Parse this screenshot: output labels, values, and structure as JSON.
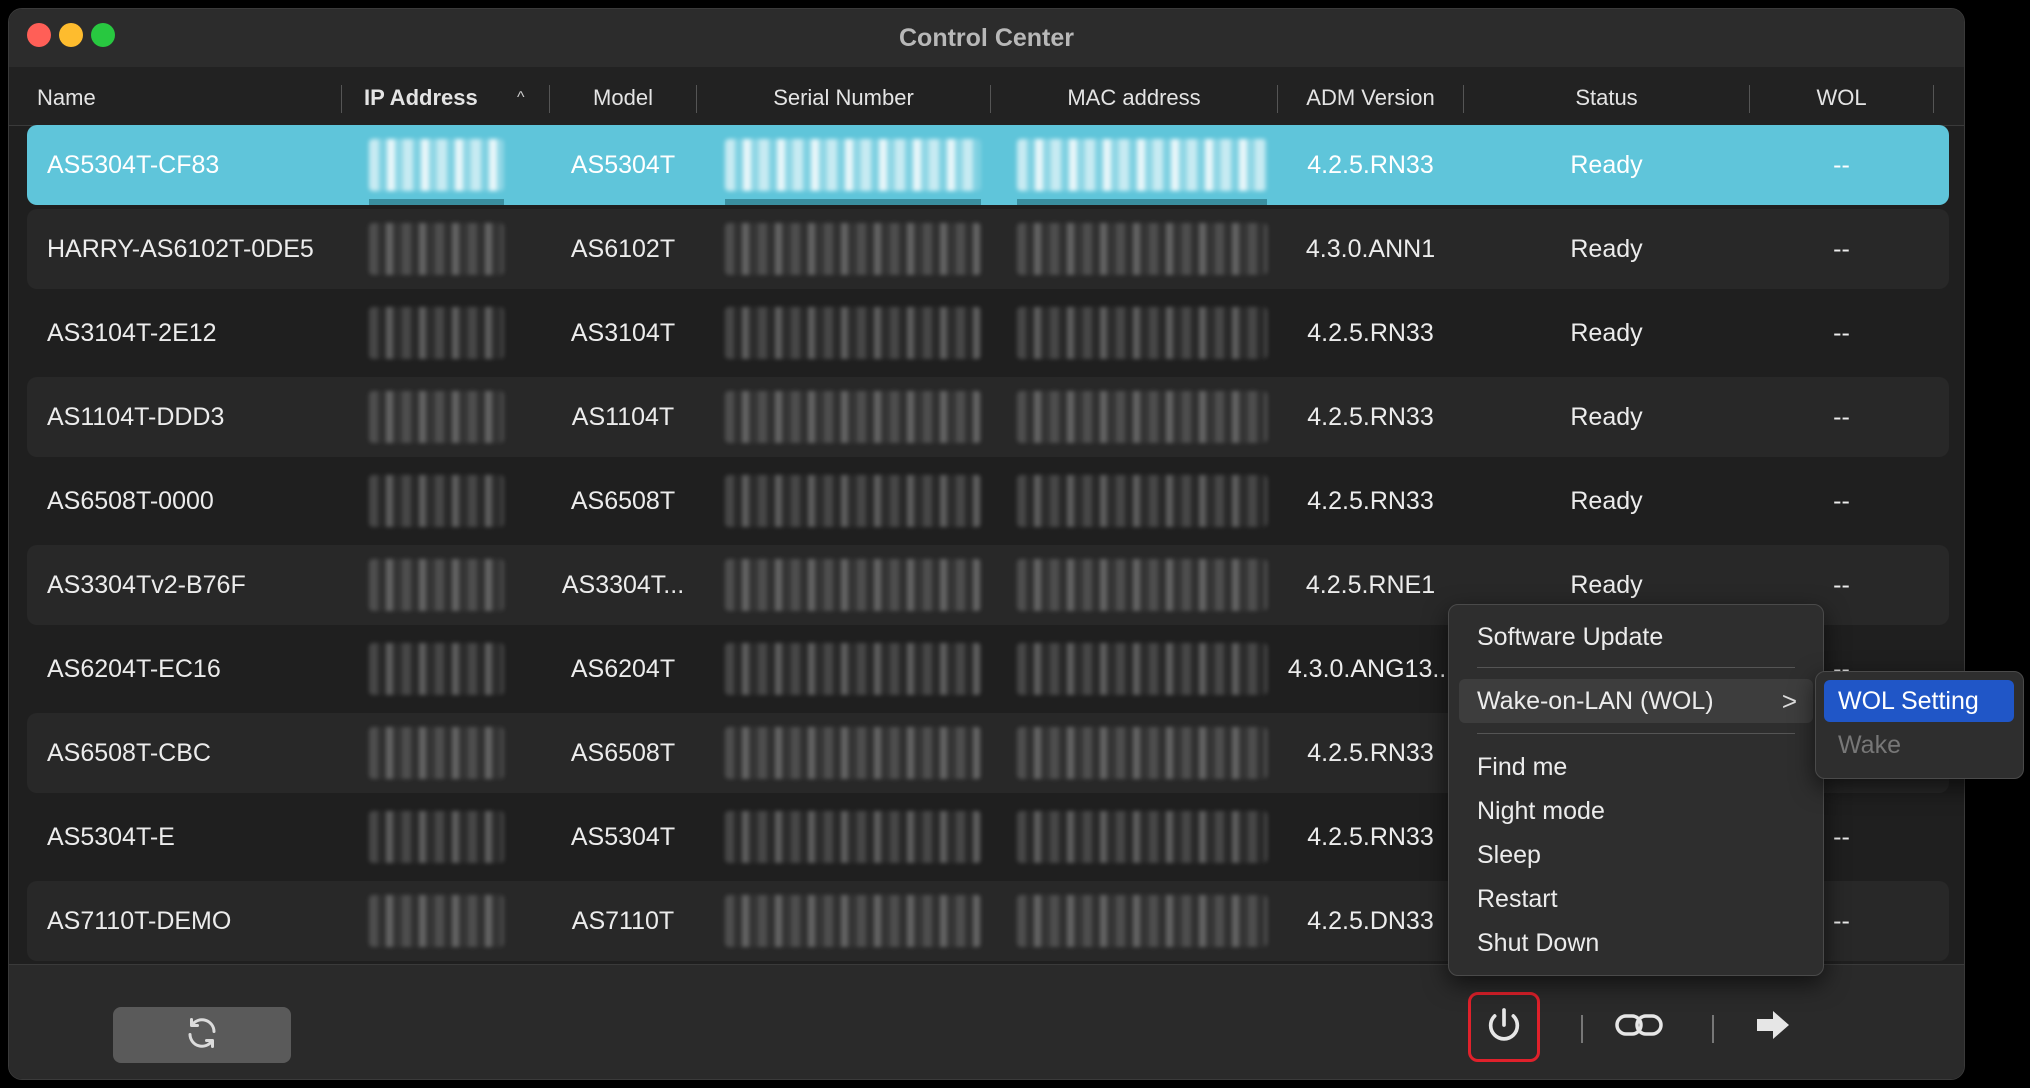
{
  "window": {
    "title": "Control Center"
  },
  "columns": [
    {
      "key": "name",
      "label": "Name"
    },
    {
      "key": "ip",
      "label": "IP Address",
      "sorted": true,
      "sort_indicator": "^"
    },
    {
      "key": "model",
      "label": "Model"
    },
    {
      "key": "serial",
      "label": "Serial Number"
    },
    {
      "key": "mac",
      "label": "MAC address"
    },
    {
      "key": "adm",
      "label": "ADM Version"
    },
    {
      "key": "status",
      "label": "Status"
    },
    {
      "key": "wol",
      "label": "WOL"
    }
  ],
  "rows": [
    {
      "name": "AS5304T-CF83",
      "model": "AS5304T",
      "adm": "4.2.5.RN33",
      "status": "Ready",
      "wol": "--",
      "selected": true
    },
    {
      "name": "HARRY-AS6102T-0DE5",
      "model": "AS6102T",
      "adm": "4.3.0.ANN1",
      "status": "Ready",
      "wol": "--"
    },
    {
      "name": "AS3104T-2E12",
      "model": "AS3104T",
      "adm": "4.2.5.RN33",
      "status": "Ready",
      "wol": "--"
    },
    {
      "name": "AS1104T-DDD3",
      "model": "AS1104T",
      "adm": "4.2.5.RN33",
      "status": "Ready",
      "wol": "--"
    },
    {
      "name": "AS6508T-0000",
      "model": "AS6508T",
      "adm": "4.2.5.RN33",
      "status": "Ready",
      "wol": "--"
    },
    {
      "name": "AS3304Tv2-B76F",
      "model": "AS3304T...",
      "adm": "4.2.5.RNE1",
      "status": "Ready",
      "wol": "--"
    },
    {
      "name": "AS6204T-EC16",
      "model": "AS6204T",
      "adm": "4.3.0.ANG13...",
      "status": "",
      "wol": "--"
    },
    {
      "name": "AS6508T-CBC",
      "model": "AS6508T",
      "adm": "4.2.5.RN33",
      "status": "",
      "wol": ""
    },
    {
      "name": "AS5304T-E",
      "model": "AS5304T",
      "adm": "4.2.5.RN33",
      "status": "",
      "wol": "--"
    },
    {
      "name": "AS7110T-DEMO",
      "model": "AS7110T",
      "adm": "4.2.5.DN33",
      "status": "",
      "wol": "--"
    }
  ],
  "context_menu": {
    "software_update": "Software Update",
    "wol": "Wake-on-LAN (WOL)",
    "wol_chevron": ">",
    "find_me": "Find me",
    "night_mode": "Night mode",
    "sleep": "Sleep",
    "restart": "Restart",
    "shut_down": "Shut Down"
  },
  "wol_submenu": {
    "setting": "WOL Setting",
    "wake": "Wake"
  },
  "toolbar": {
    "refresh_icon": "refresh-icon",
    "power_icon": "power-icon",
    "link_icon": "link-icon",
    "arrow_icon": "arrow-right-icon"
  },
  "colors": {
    "selected_row": "#5fc5da",
    "submenu_active": "#2056c7",
    "power_highlight": "#e0212b"
  }
}
